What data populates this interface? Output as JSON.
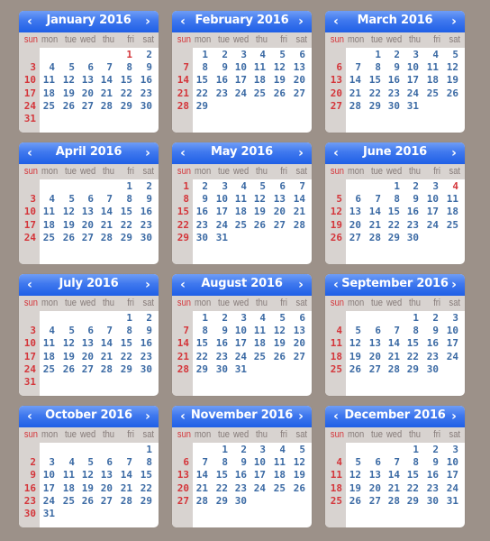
{
  "year": 2016,
  "weekdays": [
    "sun",
    "mon",
    "tue",
    "wed",
    "thu",
    "fri",
    "sat"
  ],
  "nav": {
    "prev_icon": "‹",
    "next_icon": "›"
  },
  "colors": {
    "background": "#9c9189",
    "header_blue": "#3f78ee",
    "weekday_text": "#857a78",
    "date_blue": "#3b6aa4",
    "sunday_red": "#d4353a",
    "side_gray": "#d8d3d0"
  },
  "months": [
    {
      "title": "January 2016",
      "first_weekday": 5,
      "days": 31,
      "holidays": [
        1
      ]
    },
    {
      "title": "February 2016",
      "first_weekday": 1,
      "days": 29,
      "holidays": []
    },
    {
      "title": "March 2016",
      "first_weekday": 2,
      "days": 31,
      "holidays": []
    },
    {
      "title": "April 2016",
      "first_weekday": 5,
      "days": 30,
      "holidays": []
    },
    {
      "title": "May 2016",
      "first_weekday": 0,
      "days": 31,
      "holidays": []
    },
    {
      "title": "June 2016",
      "first_weekday": 3,
      "days": 30,
      "holidays": [
        4
      ]
    },
    {
      "title": "July 2016",
      "first_weekday": 5,
      "days": 31,
      "holidays": []
    },
    {
      "title": "August 2016",
      "first_weekday": 1,
      "days": 31,
      "holidays": []
    },
    {
      "title": "September 2016",
      "first_weekday": 4,
      "days": 30,
      "holidays": []
    },
    {
      "title": "October 2016",
      "first_weekday": 6,
      "days": 31,
      "holidays": []
    },
    {
      "title": "November 2016",
      "first_weekday": 2,
      "days": 30,
      "holidays": []
    },
    {
      "title": "December 2016",
      "first_weekday": 4,
      "days": 31,
      "holidays": []
    }
  ]
}
